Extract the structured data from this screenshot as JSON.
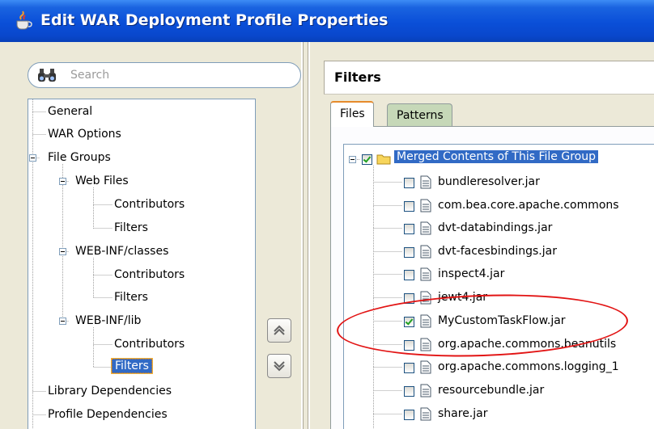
{
  "window": {
    "title": "Edit WAR Deployment Profile Properties"
  },
  "search": {
    "placeholder": "Search"
  },
  "nav_tree": [
    {
      "label": "General",
      "level": 0,
      "expander": false
    },
    {
      "label": "WAR Options",
      "level": 0,
      "expander": false
    },
    {
      "label": "File Groups",
      "level": 0,
      "expander": true
    },
    {
      "label": "Web Files",
      "level": 1,
      "expander": true
    },
    {
      "label": "Contributors",
      "level": 2,
      "expander": false
    },
    {
      "label": "Filters",
      "level": 2,
      "expander": false
    },
    {
      "label": "WEB-INF/classes",
      "level": 1,
      "expander": true
    },
    {
      "label": "Contributors",
      "level": 2,
      "expander": false
    },
    {
      "label": "Filters",
      "level": 2,
      "expander": false
    },
    {
      "label": "WEB-INF/lib",
      "level": 1,
      "expander": true
    },
    {
      "label": "Contributors",
      "level": 2,
      "expander": false
    },
    {
      "label": "Filters",
      "level": 2,
      "expander": false,
      "selected": true
    },
    {
      "label": "Library Dependencies",
      "level": 0,
      "expander": false
    },
    {
      "label": "Profile Dependencies",
      "level": 0,
      "expander": false
    }
  ],
  "move_buttons": {
    "up": "move-up-icon",
    "down": "move-down-icon"
  },
  "right_panel": {
    "title": "Filters"
  },
  "tabs": [
    {
      "label": "Files",
      "active": true
    },
    {
      "label": "Patterns",
      "active": false
    }
  ],
  "file_tree": {
    "root": {
      "label": "Merged Contents of This File Group",
      "checked": true
    },
    "items": [
      {
        "label": "bundleresolver.jar",
        "checked": false
      },
      {
        "label": "com.bea.core.apache.commons",
        "checked": false
      },
      {
        "label": "dvt-databindings.jar",
        "checked": false
      },
      {
        "label": "dvt-facesbindings.jar",
        "checked": false
      },
      {
        "label": "inspect4.jar",
        "checked": false
      },
      {
        "label": "jewt4.jar",
        "checked": false
      },
      {
        "label": "MyCustomTaskFlow.jar",
        "checked": true
      },
      {
        "label": "org.apache.commons.beanutils",
        "checked": false
      },
      {
        "label": "org.apache.commons.logging_1",
        "checked": false
      },
      {
        "label": "resourcebundle.jar",
        "checked": false
      },
      {
        "label": "share.jar",
        "checked": false
      }
    ]
  },
  "colors": {
    "titlebar": "#0a4fd8",
    "selection": "#316ac5",
    "annotation": "#e21414",
    "check": "#21a121"
  }
}
